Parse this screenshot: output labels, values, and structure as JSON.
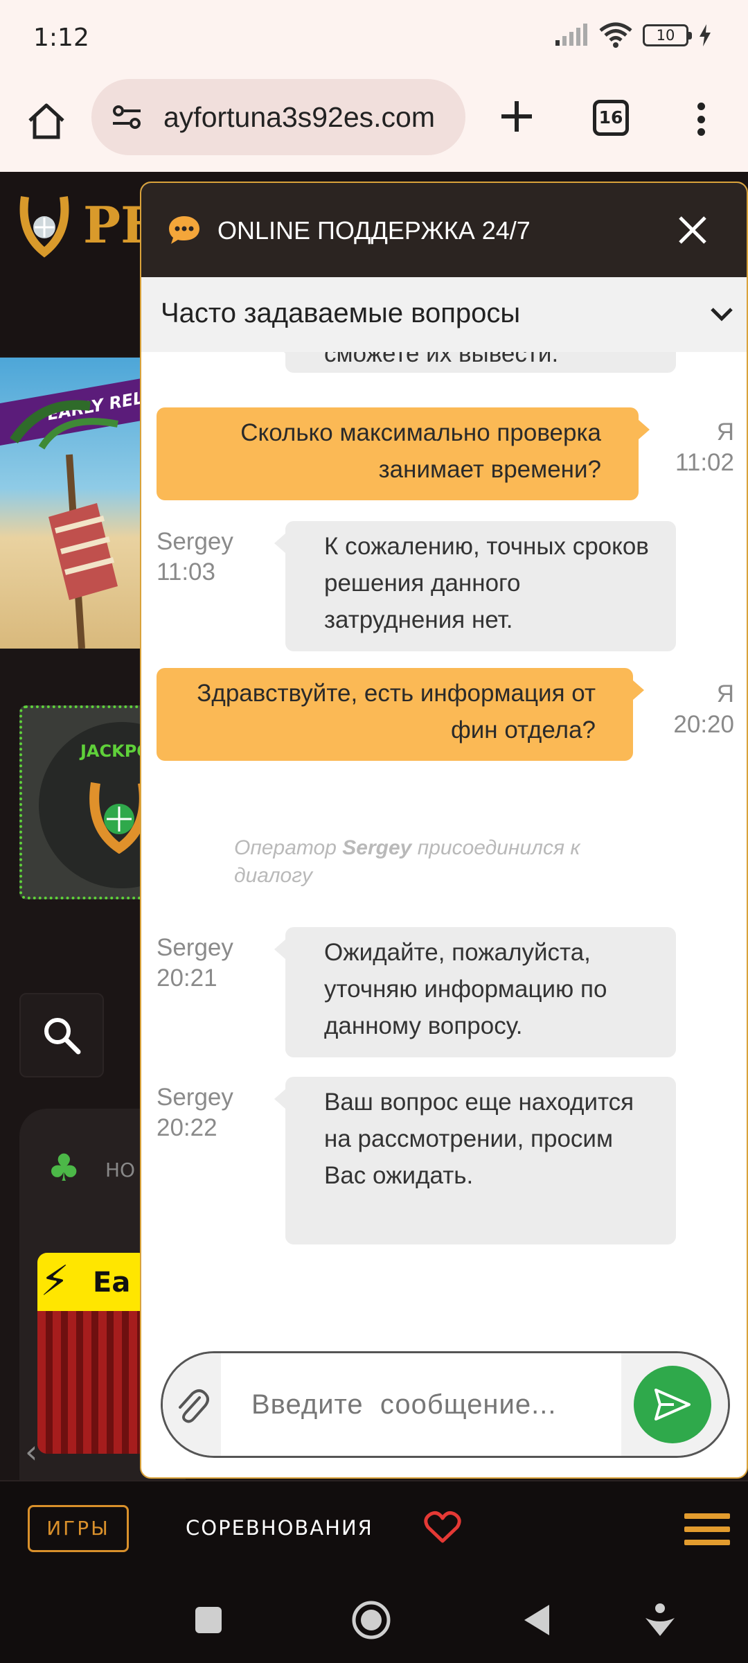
{
  "status_bar": {
    "time": "1:12",
    "battery": "10"
  },
  "browser": {
    "url": "ayfortuna3s92es.com",
    "tab_count": "16"
  },
  "site": {
    "logo_text": "PF",
    "banner_text": "EARLY REL",
    "jackpot_label": "JACKPO",
    "games_heading": "НО",
    "promo_text": "Ea",
    "bottom_nav": {
      "games": "ИГРЫ",
      "competitions": "СОРЕВНОВАНИЯ"
    }
  },
  "chat": {
    "title": "ONLINE ПОДДЕРЖКА 24/7",
    "faq_title": "Часто задаваемые вопросы",
    "messages": [
      {
        "text": "сможете их вывести."
      },
      {
        "text": "Сколько максимально проверка занимает времени?",
        "author": "Я",
        "time": "11:02"
      },
      {
        "text": "К сожалению, точных сроков решения данного затруднения нет.",
        "author": "Sergey",
        "time": "11:03"
      },
      {
        "text": "Здравствуйте, есть информация от фин отдела?",
        "author": "Я",
        "time": "20:20"
      },
      {
        "text": "Ожидайте, пожалуйста, уточняю информацию по данному вопросу.",
        "author": "Sergey",
        "time": "20:21"
      },
      {
        "text": "Ваш вопрос еще находится на рассмотрении, просим Вас ожидать.",
        "author": "Sergey",
        "time": "20:22"
      }
    ],
    "system_note": {
      "prefix": "Оператор",
      "operator": "Sergey",
      "suffix": "присоединился к диалогу"
    },
    "input_placeholder": "Введите  сообщение..."
  },
  "colors": {
    "accent": "#fbb955",
    "send": "#2fa94b",
    "header": "#2b2421",
    "brand_gold": "#d9902b"
  },
  "icons": {
    "home": "home-icon",
    "site_settings": "site-settings-icon",
    "new_tab": "plus-icon",
    "menu": "kebab-menu-icon",
    "chat": "chat-bubble-icon",
    "close": "close-icon",
    "faq_toggle": "chevron-down-icon",
    "attach": "paperclip-icon",
    "send": "send-icon",
    "favorites": "heart-icon",
    "site_menu": "hamburger-icon",
    "search": "search-icon"
  }
}
